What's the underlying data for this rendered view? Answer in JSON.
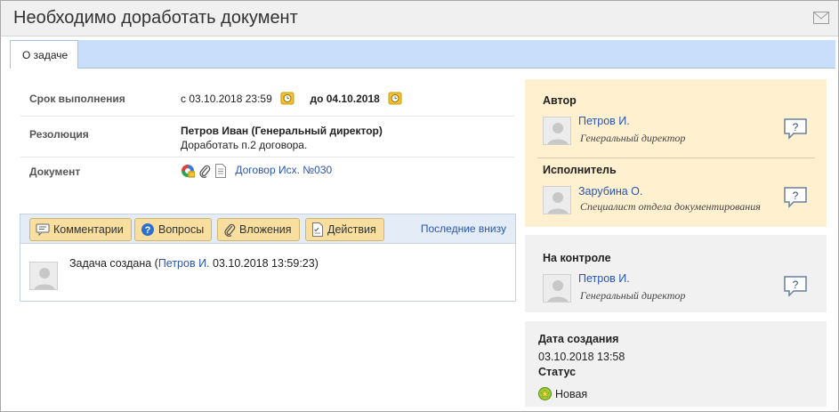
{
  "window": {
    "title": "Необходимо доработать документ",
    "mail_icon": "envelope-icon"
  },
  "tabs": [
    {
      "label": "О задаче",
      "active": true
    }
  ],
  "details": {
    "deadline": {
      "label": "Срок выполнения",
      "from": "с 03.10.2018 23:59",
      "to_prefix": "до",
      "to": "04.10.2018"
    },
    "resolution": {
      "label": "Резолюция",
      "person": "Петров Иван (Генеральный директор)",
      "text": "Доработать п.2 договора."
    },
    "document": {
      "label": "Документ",
      "link": "Договор Исх. №030"
    }
  },
  "comments": {
    "toolbar": {
      "comments": "Комментарии",
      "questions": "Вопросы",
      "attachments": "Вложения",
      "actions": "Действия",
      "last_below": "Последние внизу"
    },
    "items": [
      {
        "text": "Задача создана",
        "paren_open": " (",
        "author": "Петров И.",
        "time": " 03.10.2018 13:59:23)"
      }
    ]
  },
  "author_panel": {
    "author_title": "Автор",
    "author": {
      "name": "Петров И.",
      "role": "Генеральный директор"
    },
    "executor_title": "Исполнитель",
    "executor": {
      "name": "Зарубина О.",
      "role": "Специалист отдела документирования"
    }
  },
  "control_panel": {
    "title": "На контроле",
    "person": {
      "name": "Петров И.",
      "role": "Генеральный директор"
    }
  },
  "info_panel": {
    "created_label": "Дата создания",
    "created_value": "03.10.2018 13:58",
    "status_label": "Статус",
    "status_value": "Новая"
  },
  "colors": {
    "link": "#2a55b3",
    "author_bg": "#fff0cf",
    "panel_bg": "#f1f1f1",
    "tab_bar": "#c9defa",
    "button": "#f8dfa0"
  }
}
